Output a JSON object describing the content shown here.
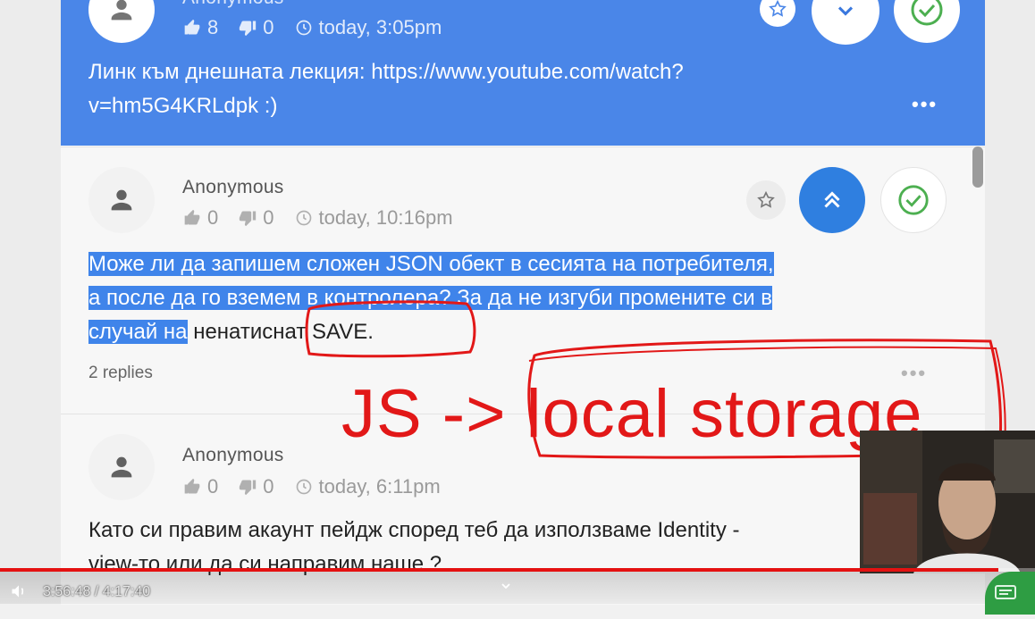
{
  "progress": {
    "elapsed": "3:56:48",
    "separator": " / ",
    "total": "4:17:40",
    "fraction": 0.9646
  },
  "colors": {
    "accent": "#4a86e8",
    "annotation": "#e21818",
    "check": "#4caf50",
    "progress": "#e41111"
  },
  "questions": [
    {
      "author": "Anonymous",
      "upvotes": "8",
      "downvotes": "0",
      "time": "today, 3:05pm",
      "text_line1": "Линк към днешната лекция: https://www.youtube.com/watch?",
      "text_line2": "v=hm5G4KRLdpk :)",
      "more": "•••"
    },
    {
      "author": "Anonymous",
      "upvotes": "0",
      "downvotes": "0",
      "time": "today, 10:16pm",
      "line1_sel": "Може ли да запишем сложен JSON обект в сесията на потребителя,",
      "line2_sel": "а после да го вземем в контролера? За да не изгуби промените си в",
      "line3_sel": "случай на",
      "line3_rest": " ненатиснат SAVE.",
      "replies": "2 replies",
      "more": "•••"
    },
    {
      "author": "Anonymous",
      "upvotes": "0",
      "downvotes": "0",
      "time": "today, 6:11pm",
      "text_line1": "Като си правим акаунт пейдж според теб да използваме Identity -",
      "text_line2": "view-то или да си направим наше ?"
    }
  ],
  "annotation": {
    "text": "JS -> local storage"
  },
  "icons": [
    "user-icon",
    "thumbs-up-icon",
    "thumbs-down-icon",
    "clock-icon",
    "star-icon",
    "chevron-down-icon",
    "chevron-double-up-icon",
    "check-circle-icon",
    "volume-icon",
    "settings-badge-icon"
  ]
}
